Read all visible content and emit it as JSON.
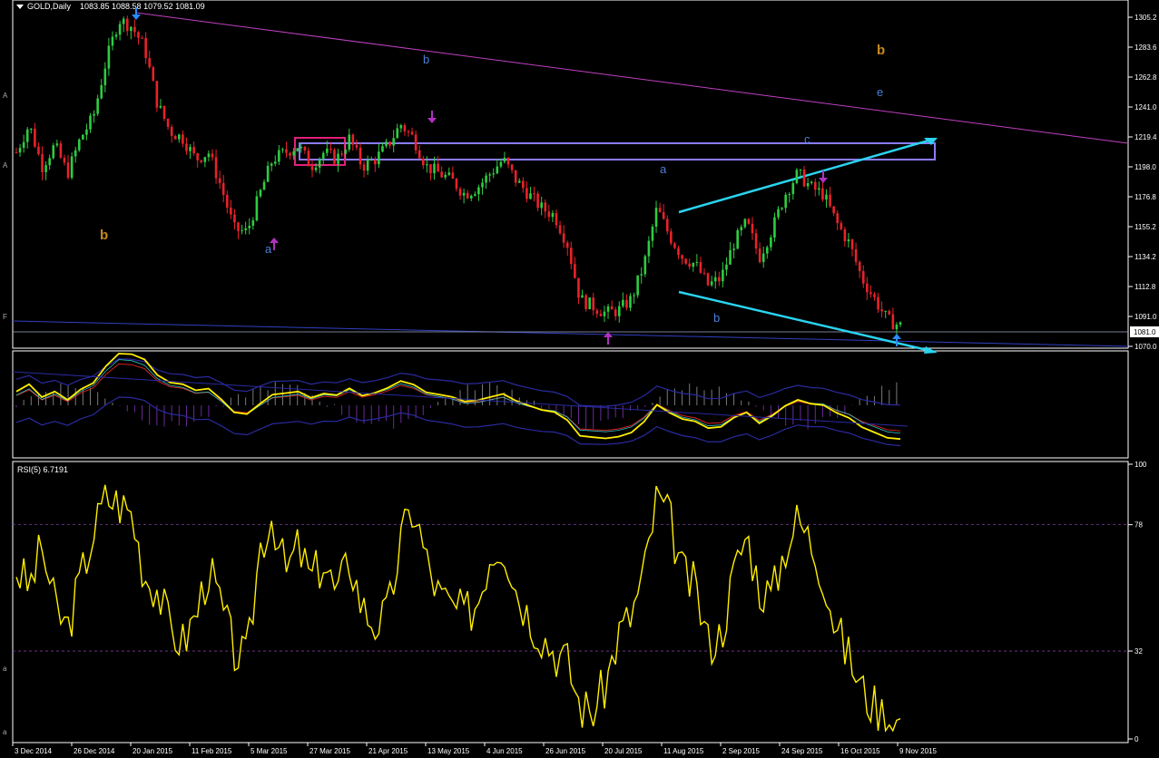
{
  "chart_window": {
    "symbol_header": "GOLD,Daily",
    "ohlc": "1083.85 1088.58 1079.52 1081.09",
    "dropdown_icon": "triangle-down-icon",
    "current_price_label": "1081.0"
  },
  "price_axis": {
    "ticks": [
      "1305.2",
      "1283.6",
      "1262.8",
      "1241.0",
      "1219.4",
      "1198.0",
      "1176.8",
      "1155.2",
      "1134.2",
      "1112.8",
      "1091.0",
      "1070.0"
    ]
  },
  "rsi_panel": {
    "header": "RSI(5) 6.7191",
    "ticks": [
      "100",
      "78",
      "32",
      "0"
    ]
  },
  "date_axis": {
    "labels": [
      "3 Dec 2014",
      "26 Dec 2014",
      "20 Jan 2015",
      "11 Feb 2015",
      "5 Mar 2015",
      "27 Mar 2015",
      "21 Apr 2015",
      "13 May 2015",
      "4 Jun 2015",
      "26 Jun 2015",
      "20 Jul 2015",
      "11 Aug 2015",
      "2 Sep 2015",
      "24 Sep 2015",
      "16 Oct 2015",
      "9 Nov 2015"
    ]
  },
  "wave_labels": [
    {
      "text": "b",
      "color": "#c98a1e"
    },
    {
      "text": "b",
      "color": "#c98a1e"
    },
    {
      "text": "b",
      "color": "#4a7fd6"
    },
    {
      "text": "a",
      "color": "#4a7fd6"
    },
    {
      "text": "a",
      "color": "#4a7fd6"
    },
    {
      "text": "b",
      "color": "#4a7fd6"
    },
    {
      "text": "c",
      "color": "#4a7fd6"
    },
    {
      "text": "e",
      "color": "#4a7fd6"
    }
  ],
  "left_edge_marks": [
    "A",
    "A",
    "F",
    "a",
    "a"
  ],
  "colors": {
    "bull_candle": "#2ecc40",
    "bear_candle": "#e8222a",
    "rsi_line": "#ffee00",
    "trendline": "#c040c0",
    "channel_lines": "#2ad4f0",
    "rect_box": "#8a7cff",
    "pink_box": "#e0207a",
    "arrow_up": "#b030c0",
    "arrow_down": "#2a8cff"
  },
  "chart_data": {
    "type": "line",
    "rsi_levels": [
      78,
      32
    ],
    "rsi_ylim": [
      0,
      100
    ],
    "price_ylim": [
      1065,
      1310
    ],
    "price_path": [
      1205,
      1225,
      1195,
      1210,
      1190,
      1215,
      1230,
      1270,
      1300,
      1295,
      1280,
      1240,
      1220,
      1215,
      1200,
      1205,
      1180,
      1150,
      1148,
      1175,
      1200,
      1205,
      1210,
      1195,
      1205,
      1200,
      1215,
      1195,
      1200,
      1210,
      1225,
      1215,
      1195,
      1190,
      1185,
      1175,
      1180,
      1190,
      1200,
      1185,
      1175,
      1165,
      1160,
      1140,
      1100,
      1095,
      1090,
      1092,
      1100,
      1125,
      1165,
      1145,
      1130,
      1125,
      1110,
      1115,
      1140,
      1155,
      1130,
      1150,
      1175,
      1190,
      1180,
      1175,
      1155,
      1140,
      1115,
      1100,
      1085,
      1081
    ],
    "rsi_series": [
      62,
      55,
      70,
      48,
      40,
      58,
      75,
      88,
      86,
      82,
      60,
      55,
      40,
      35,
      45,
      62,
      48,
      32,
      28,
      70,
      82,
      60,
      70,
      58,
      65,
      52,
      66,
      48,
      42,
      45,
      72,
      85,
      65,
      52,
      48,
      45,
      50,
      68,
      72,
      55,
      45,
      38,
      32,
      28,
      12,
      10,
      20,
      38,
      45,
      60,
      88,
      80,
      60,
      55,
      35,
      38,
      60,
      75,
      55,
      52,
      70,
      80,
      72,
      60,
      40,
      30,
      18,
      12,
      8,
      6
    ]
  }
}
